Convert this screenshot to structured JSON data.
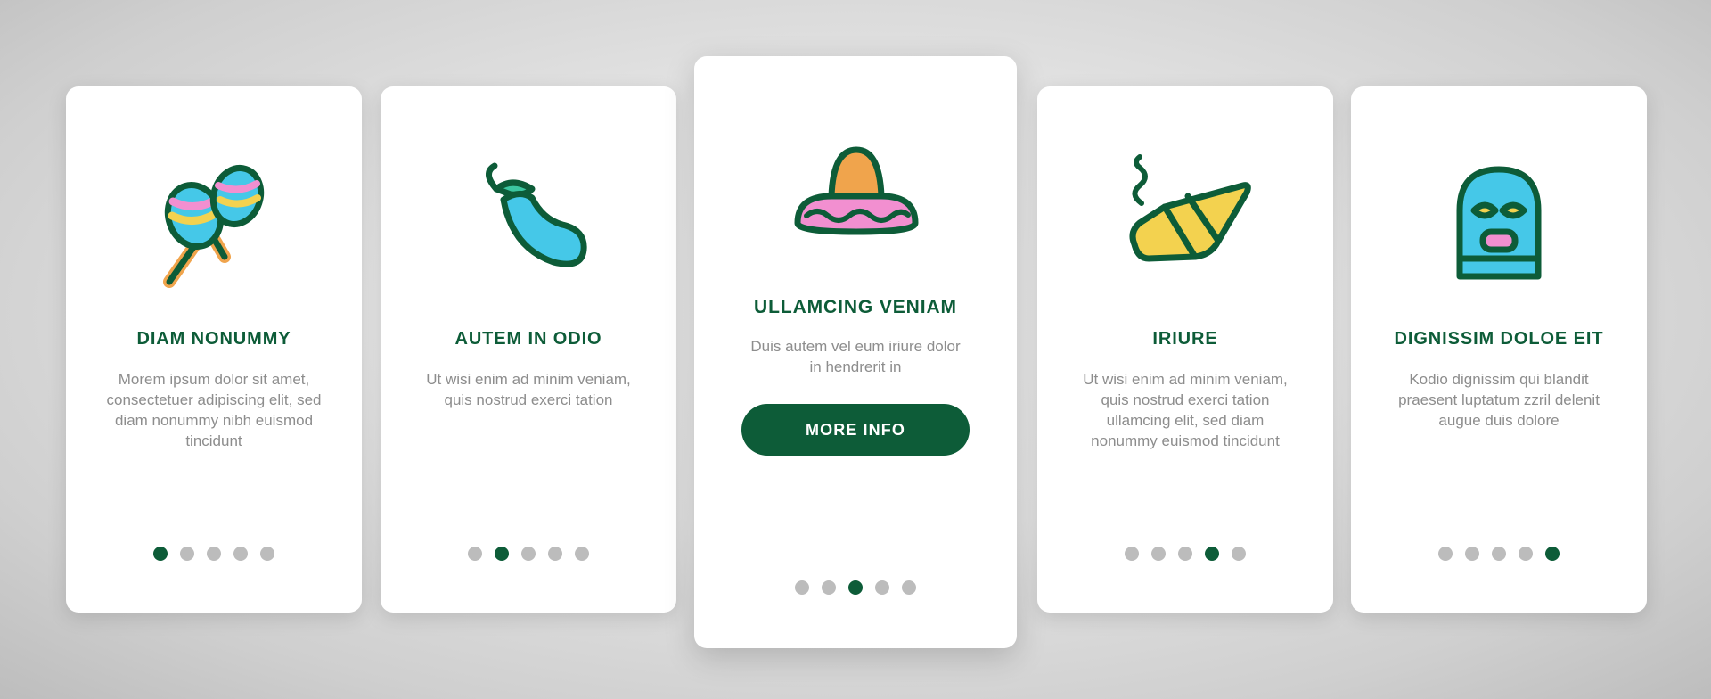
{
  "screen": {
    "background_top": "#e9e9e9",
    "background_bottom": "#bdbdbd"
  },
  "palette": {
    "green": "#0d5c38",
    "cyan": "#45c8e8",
    "orange": "#f0a44c",
    "pink": "#f28fd0",
    "yellow": "#f3d24f",
    "dot_inactive": "#bcbcbc"
  },
  "cards": [
    {
      "icon": "maracas-icon",
      "title": "DIAM NONUMMY",
      "description": "Morem ipsum dolor sit amet, consectetuer adipiscing elit, sed diam nonummy nibh euismod tincidunt",
      "dots": {
        "count": 5,
        "active_index": 0
      },
      "featured": false
    },
    {
      "icon": "chili-pepper-icon",
      "title": "AUTEM IN ODIO",
      "description": "Ut wisi enim ad minim veniam, quis nostrud exerci tation",
      "dots": {
        "count": 5,
        "active_index": 1
      },
      "featured": false
    },
    {
      "icon": "sombrero-hat-icon",
      "title": "ULLAMCING VENIAM",
      "description": "Duis autem vel eum iriure dolor in hendrerit in",
      "button_label": "MORE INFO",
      "dots": {
        "count": 5,
        "active_index": 2
      },
      "featured": true
    },
    {
      "icon": "cigar-icon",
      "title": "IRIURE",
      "description": "Ut wisi enim ad minim veniam, quis nostrud exerci tation ullamcing elit, sed diam nonummy euismod tincidunt",
      "dots": {
        "count": 5,
        "active_index": 3
      },
      "featured": false
    },
    {
      "icon": "luchador-mask-icon",
      "title": "DIGNISSIM DOLOE EIT",
      "description": "Kodio dignissim qui blandit praesent luptatum zzril delenit augue duis dolore",
      "dots": {
        "count": 5,
        "active_index": 4
      },
      "featured": false
    }
  ]
}
